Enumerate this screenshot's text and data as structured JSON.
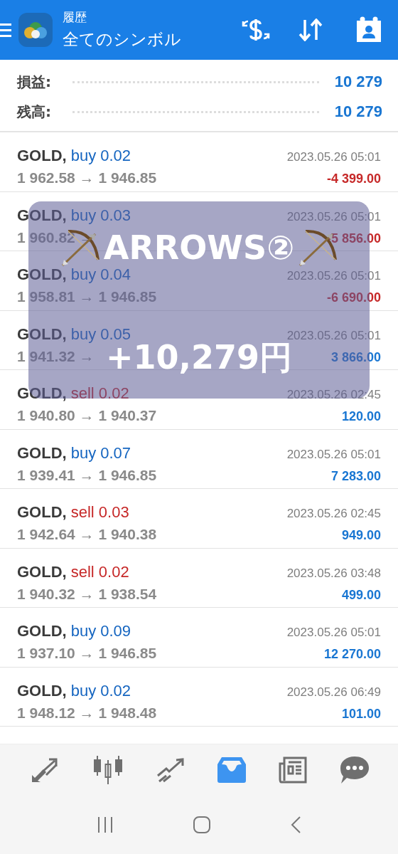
{
  "header": {
    "subtitle": "履歴",
    "title": "全てのシンボル"
  },
  "summary": [
    {
      "label": "損益:",
      "value": "10 279"
    },
    {
      "label": "残高:",
      "value": "10 279"
    }
  ],
  "trades": [
    {
      "symbol": "GOLD,",
      "type": {
        "text": "buy 0.02",
        "kind": "buy"
      },
      "prices": "1 962.58 → 1 946.85",
      "time": "2023.05.26 05:01",
      "profit": {
        "text": "-4 399.00",
        "kind": "loss"
      }
    },
    {
      "symbol": "GOLD,",
      "type": {
        "text": "buy 0.03",
        "kind": "buy"
      },
      "prices": "1 960.82 →",
      "time": "2023.05.26 05:01",
      "profit": {
        "text": "-5 856.00",
        "kind": "loss"
      }
    },
    {
      "symbol": "GOLD,",
      "type": {
        "text": "buy 0.04",
        "kind": "buy"
      },
      "prices": "1 958.81 → 1 946.85",
      "time": "2023.05.26 05:01",
      "profit": {
        "text": "-6 690.00",
        "kind": "loss"
      }
    },
    {
      "symbol": "GOLD,",
      "type": {
        "text": "buy 0.05",
        "kind": "buy"
      },
      "prices": "1 941.32 →",
      "time": "2023.05.26 05:01",
      "profit": {
        "text": "3 866.00",
        "kind": "gain"
      }
    },
    {
      "symbol": "GOLD,",
      "type": {
        "text": "sell 0.02",
        "kind": "sell"
      },
      "prices": "1 940.80 → 1 940.37",
      "time": "2023.05.26 02:45",
      "profit": {
        "text": "120.00",
        "kind": "gain"
      }
    },
    {
      "symbol": "GOLD,",
      "type": {
        "text": "buy 0.07",
        "kind": "buy"
      },
      "prices": "1 939.41 → 1 946.85",
      "time": "2023.05.26 05:01",
      "profit": {
        "text": "7 283.00",
        "kind": "gain"
      }
    },
    {
      "symbol": "GOLD,",
      "type": {
        "text": "sell 0.03",
        "kind": "sell"
      },
      "prices": "1 942.64 → 1 940.38",
      "time": "2023.05.26 02:45",
      "profit": {
        "text": "949.00",
        "kind": "gain"
      }
    },
    {
      "symbol": "GOLD,",
      "type": {
        "text": "sell 0.02",
        "kind": "sell"
      },
      "prices": "1 940.32 → 1 938.54",
      "time": "2023.05.26 03:48",
      "profit": {
        "text": "499.00",
        "kind": "gain"
      }
    },
    {
      "symbol": "GOLD,",
      "type": {
        "text": "buy 0.09",
        "kind": "buy"
      },
      "prices": "1 937.10 → 1 946.85",
      "time": "2023.05.26 05:01",
      "profit": {
        "text": "12 270.00",
        "kind": "gain"
      }
    },
    {
      "symbol": "GOLD,",
      "type": {
        "text": "buy 0.02",
        "kind": "buy"
      },
      "prices": "1 948.12 → 1 948.48",
      "time": "2023.05.26 06:49",
      "profit": {
        "text": "101.00",
        "kind": "gain"
      }
    }
  ],
  "overlay": {
    "title": "ARROWS②",
    "amount": "+10,279円"
  },
  "bottom_nav": [
    {
      "selected": false
    },
    {
      "selected": false
    },
    {
      "selected": false
    },
    {
      "selected": true
    },
    {
      "selected": false
    },
    {
      "selected": false
    }
  ]
}
